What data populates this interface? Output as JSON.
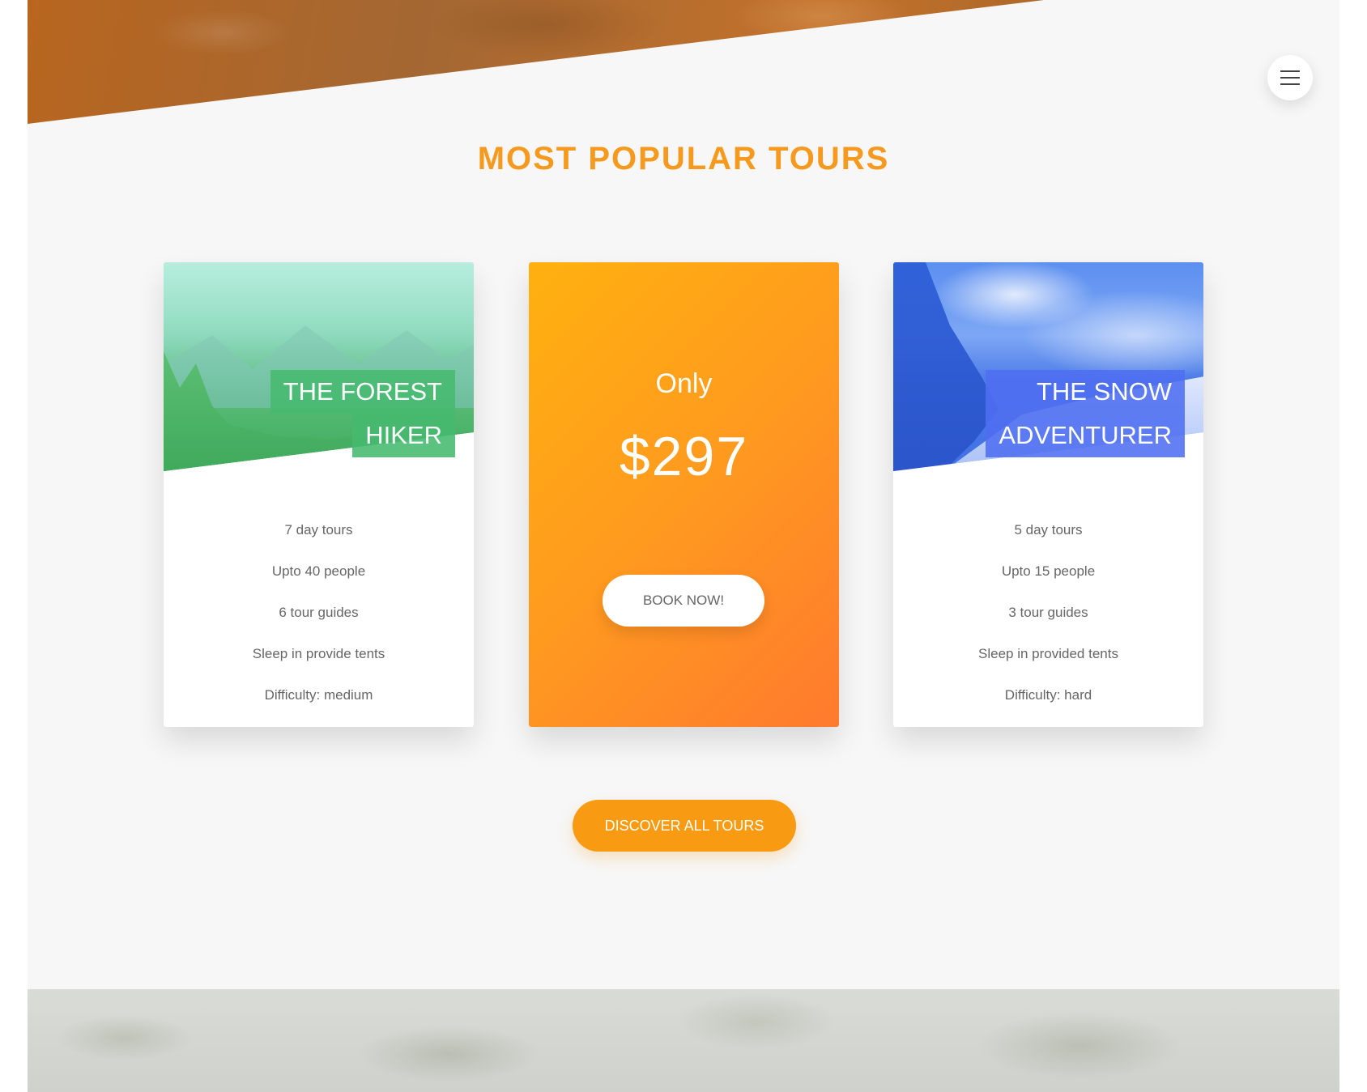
{
  "section": {
    "title": "MOST POPULAR TOURS"
  },
  "menu": {
    "icon": "hamburger-menu-icon"
  },
  "tours": [
    {
      "title_line1": "THE FOREST",
      "title_line2": "HIKER",
      "features": [
        "7 day tours",
        "Upto 40 people",
        "6 tour guides",
        "Sleep in provide tents",
        "Difficulty: medium"
      ],
      "accent": "#45ba6e"
    },
    {
      "title_line1": "THE SNOW",
      "title_line2": "ADVENTURER",
      "features": [
        "5 day tours",
        "Upto 15 people",
        "3 tour guides",
        "Sleep in provided tents",
        "Difficulty: hard"
      ],
      "accent": "#4f6ef0"
    }
  ],
  "price_card": {
    "only_label": "Only",
    "price": "$297",
    "button_label": "BOOK NOW!"
  },
  "cta": {
    "label": "DISCOVER ALL TOURS"
  },
  "colors": {
    "brand_orange": "#f89b12",
    "title_orange": "#f59a1f",
    "background": "#f7f7f7"
  }
}
